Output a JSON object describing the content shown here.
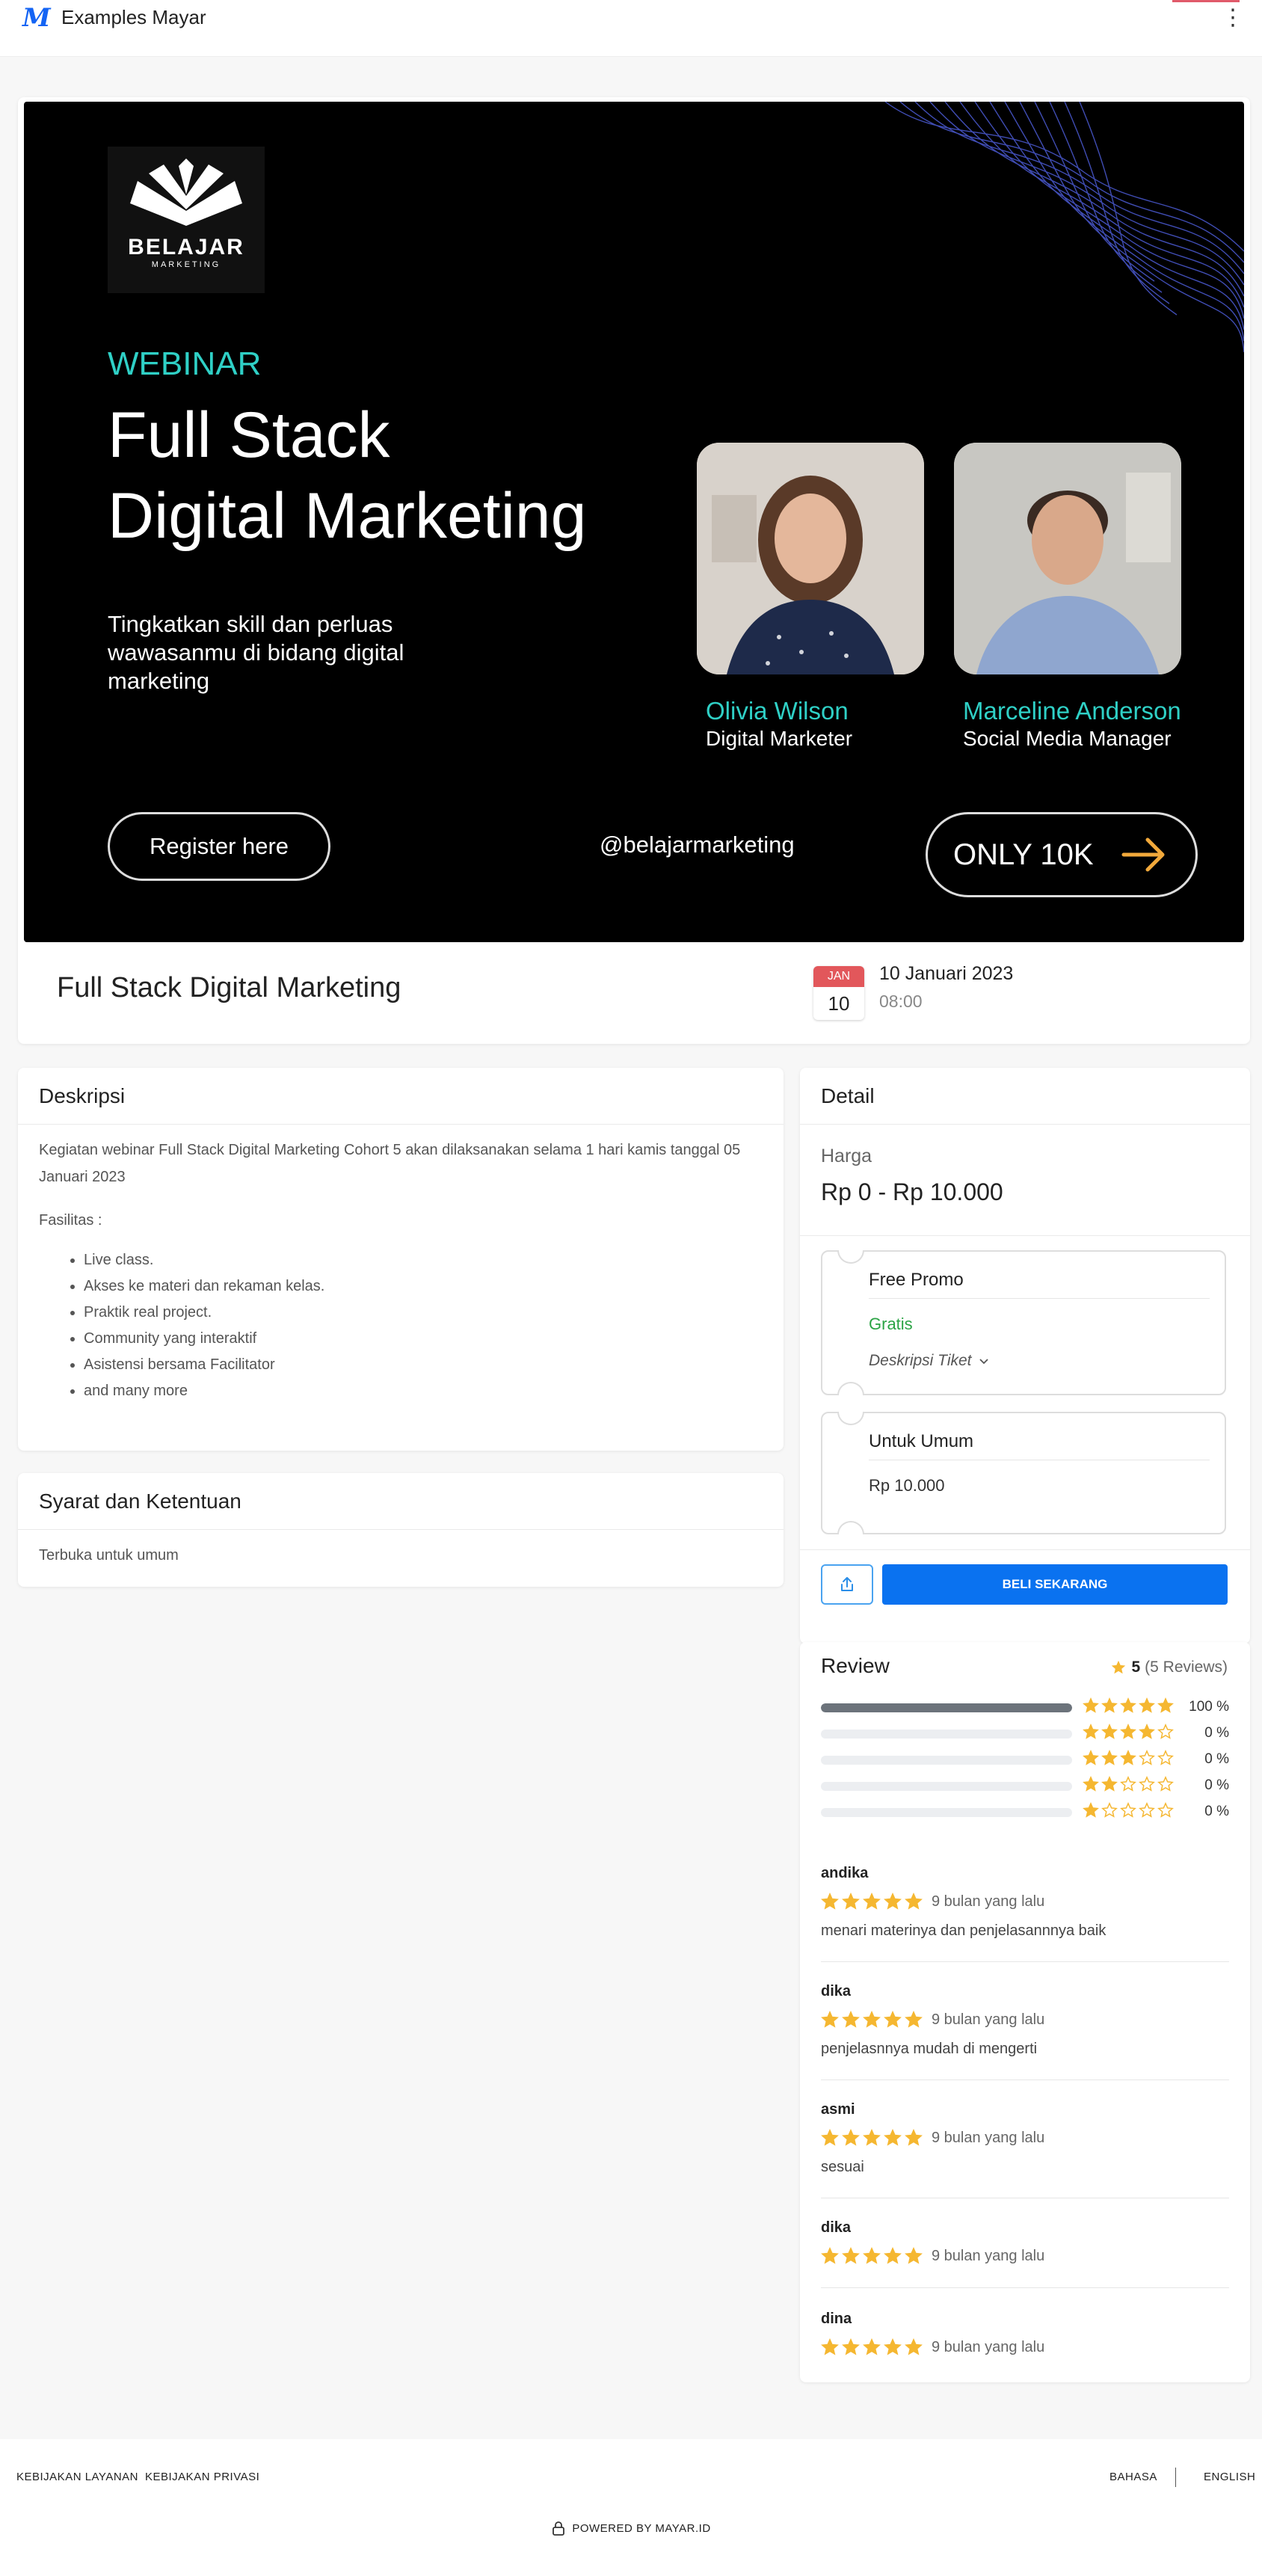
{
  "topbar": {
    "logo": "M",
    "title": "Examples Mayar",
    "menu_icon": "kebab-icon"
  },
  "banner": {
    "brand_name": "BELAJAR",
    "brand_sub": "MARKETING",
    "webinar": "WEBINAR",
    "headline_1": "Full Stack",
    "headline_2": "Digital Marketing",
    "tagline": "Tingkatkan skill dan perluas wawasanmu di bidang digital marketing",
    "speakers": [
      {
        "name": "Olivia Wilson",
        "role": "Digital Marketer"
      },
      {
        "name": "Marceline Anderson",
        "role": "Social Media Manager"
      }
    ],
    "register": "Register here",
    "handle": "@belajarmarketing",
    "only": "ONLY 10K"
  },
  "event": {
    "title": "Full Stack Digital Marketing",
    "month": "JAN",
    "day": "10",
    "date": "10 Januari 2023",
    "time": "08:00"
  },
  "description": {
    "heading": "Deskripsi",
    "paragraph": "Kegiatan webinar Full Stack Digital Marketing Cohort 5 akan dilaksanakan selama 1 hari kamis tanggal 05 Januari 2023",
    "facilities_label": "Fasilitas :",
    "facilities": [
      "Live class.",
      "Akses ke materi dan rekaman kelas.",
      "Praktik real project.",
      "Community yang interaktif",
      "Asistensi bersama Facilitator",
      "and many more"
    ]
  },
  "terms": {
    "heading": "Syarat dan Ketentuan",
    "text": "Terbuka untuk umum"
  },
  "detail": {
    "heading": "Detail",
    "price_label": "Harga",
    "price": "Rp 0 - Rp 10.000",
    "tickets": [
      {
        "name": "Free Promo",
        "price": "Gratis",
        "desc": "Deskripsi Tiket"
      },
      {
        "name": "Untuk Umum",
        "price": "Rp 10.000"
      }
    ],
    "buy": "BELI SEKARANG"
  },
  "review": {
    "heading": "Review",
    "score": "5",
    "count": "(5 Reviews)",
    "distribution": [
      {
        "stars": 5,
        "fraction": 1.0,
        "pct": "100 %"
      },
      {
        "stars": 4,
        "fraction": 0,
        "pct": "0 %"
      },
      {
        "stars": 3,
        "fraction": 0,
        "pct": "0 %"
      },
      {
        "stars": 2,
        "fraction": 0,
        "pct": "0 %"
      },
      {
        "stars": 1,
        "fraction": 0,
        "pct": "0 %"
      }
    ],
    "items": [
      {
        "name": "andika",
        "rating": 5,
        "time": "9 bulan yang lalu",
        "text": "menari materinya dan penjelasannnya baik"
      },
      {
        "name": "dika",
        "rating": 5,
        "time": "9 bulan yang lalu",
        "text": "penjelasnnya mudah di mengerti"
      },
      {
        "name": "asmi",
        "rating": 5,
        "time": "9 bulan yang lalu",
        "text": "sesuai"
      },
      {
        "name": "dika",
        "rating": 5,
        "time": "9 bulan yang lalu",
        "text": ""
      },
      {
        "name": "dina",
        "rating": 5,
        "time": "9 bulan yang lalu",
        "text": ""
      }
    ]
  },
  "footer": {
    "service_policy": "KEBIJAKAN LAYANAN",
    "privacy_policy": "KEBIJAKAN PRIVASI",
    "language_label": "BAHASA",
    "language": "ENGLISH",
    "powered": "POWERED BY MAYAR.ID"
  },
  "colors": {
    "accent": "#0a72f0",
    "star": "#f5b731",
    "teal": "#2fd0c6",
    "free": "#2aa344",
    "date_badge": "#e2575b"
  }
}
